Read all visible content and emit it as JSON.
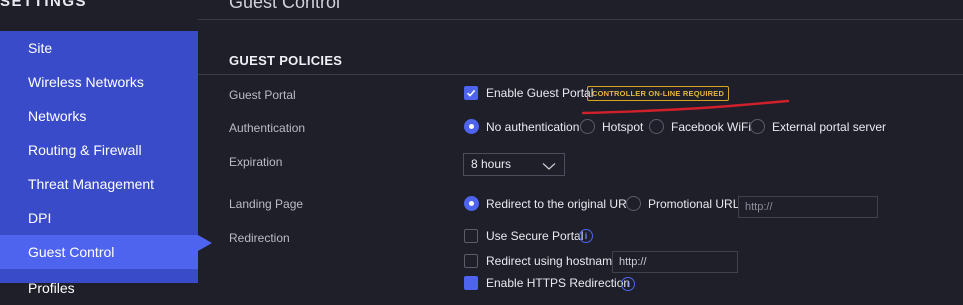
{
  "sidebar": {
    "title": "SETTINGS",
    "items": [
      {
        "label": "Site"
      },
      {
        "label": "Wireless Networks"
      },
      {
        "label": "Networks"
      },
      {
        "label": "Routing & Firewall"
      },
      {
        "label": "Threat Management"
      },
      {
        "label": "DPI"
      },
      {
        "label": "Guest Control"
      },
      {
        "label": "Profiles"
      }
    ],
    "active_item": "Guest Control"
  },
  "header": {
    "title": "Guest Control"
  },
  "section": {
    "title": "GUEST POLICIES"
  },
  "rows": {
    "guest_portal": {
      "label": "Guest Portal",
      "checkbox_label": "Enable Guest Portal",
      "checked": true,
      "badge": "CONTROLLER ON-LINE REQUIRED"
    },
    "authentication": {
      "label": "Authentication",
      "options": [
        "No authentication",
        "Hotspot",
        "Facebook WiFi",
        "External portal server"
      ],
      "selected": "No authentication"
    },
    "expiration": {
      "label": "Expiration",
      "value": "8 hours"
    },
    "landing_page": {
      "label": "Landing Page",
      "options": [
        "Redirect to the original URL",
        "Promotional URL"
      ],
      "selected": "Redirect to the original URL",
      "url_placeholder": "http://"
    },
    "redirection": {
      "label": "Redirection",
      "secure_portal_label": "Use Secure Portal",
      "hostname_label": "Redirect using hostname",
      "hostname_placeholder": "http://",
      "https_label": "Enable HTTPS Redirection"
    }
  },
  "colors": {
    "background": "#1e1f29",
    "sidebar": "#3a4bc9",
    "sidebar_active": "#4e64ef",
    "badge": "#d9a521",
    "annotation": "#d0202a"
  }
}
